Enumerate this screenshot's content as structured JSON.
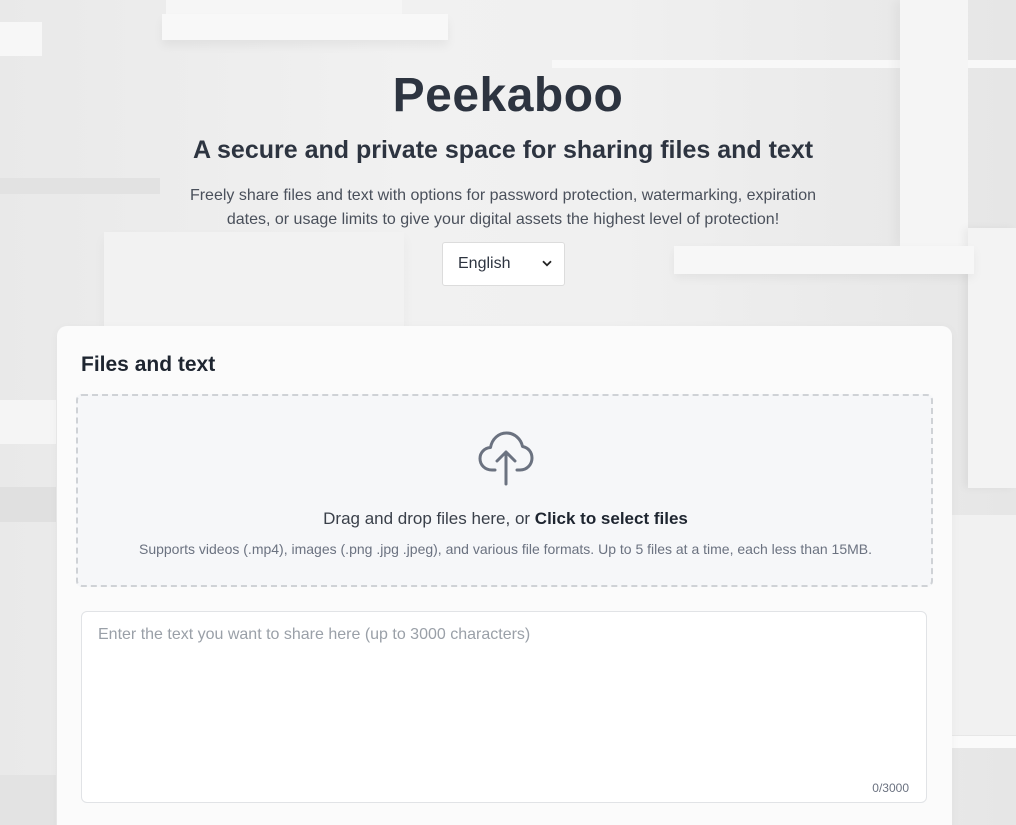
{
  "header": {
    "title": "Peekaboo",
    "subtitle": "A secure and private space for sharing files and text",
    "description": "Freely share files and text with options for password protection, watermarking, expiration dates, or usage limits to give your digital assets the highest level of protection!",
    "language": {
      "selected": "English"
    }
  },
  "card": {
    "title": "Files and text",
    "dropzone": {
      "icon": "cloud-upload-icon",
      "text_prefix": "Drag and drop files here, or ",
      "text_link": "Click to select files",
      "hint": "Supports videos (.mp4), images (.png .jpg .jpeg), and various file formats. Up to 5 files at a time, each less than 15MB."
    },
    "text_input": {
      "value": "",
      "placeholder": "Enter the text you want to share here (up to 3000 characters)",
      "counter": "0/3000"
    }
  },
  "colors": {
    "text_primary": "#2d3440",
    "text_muted": "#6b7280",
    "card_background": "#fbfbfb",
    "dropzone_background": "#f6f7f9",
    "dropzone_border": "#cfd2d6"
  }
}
